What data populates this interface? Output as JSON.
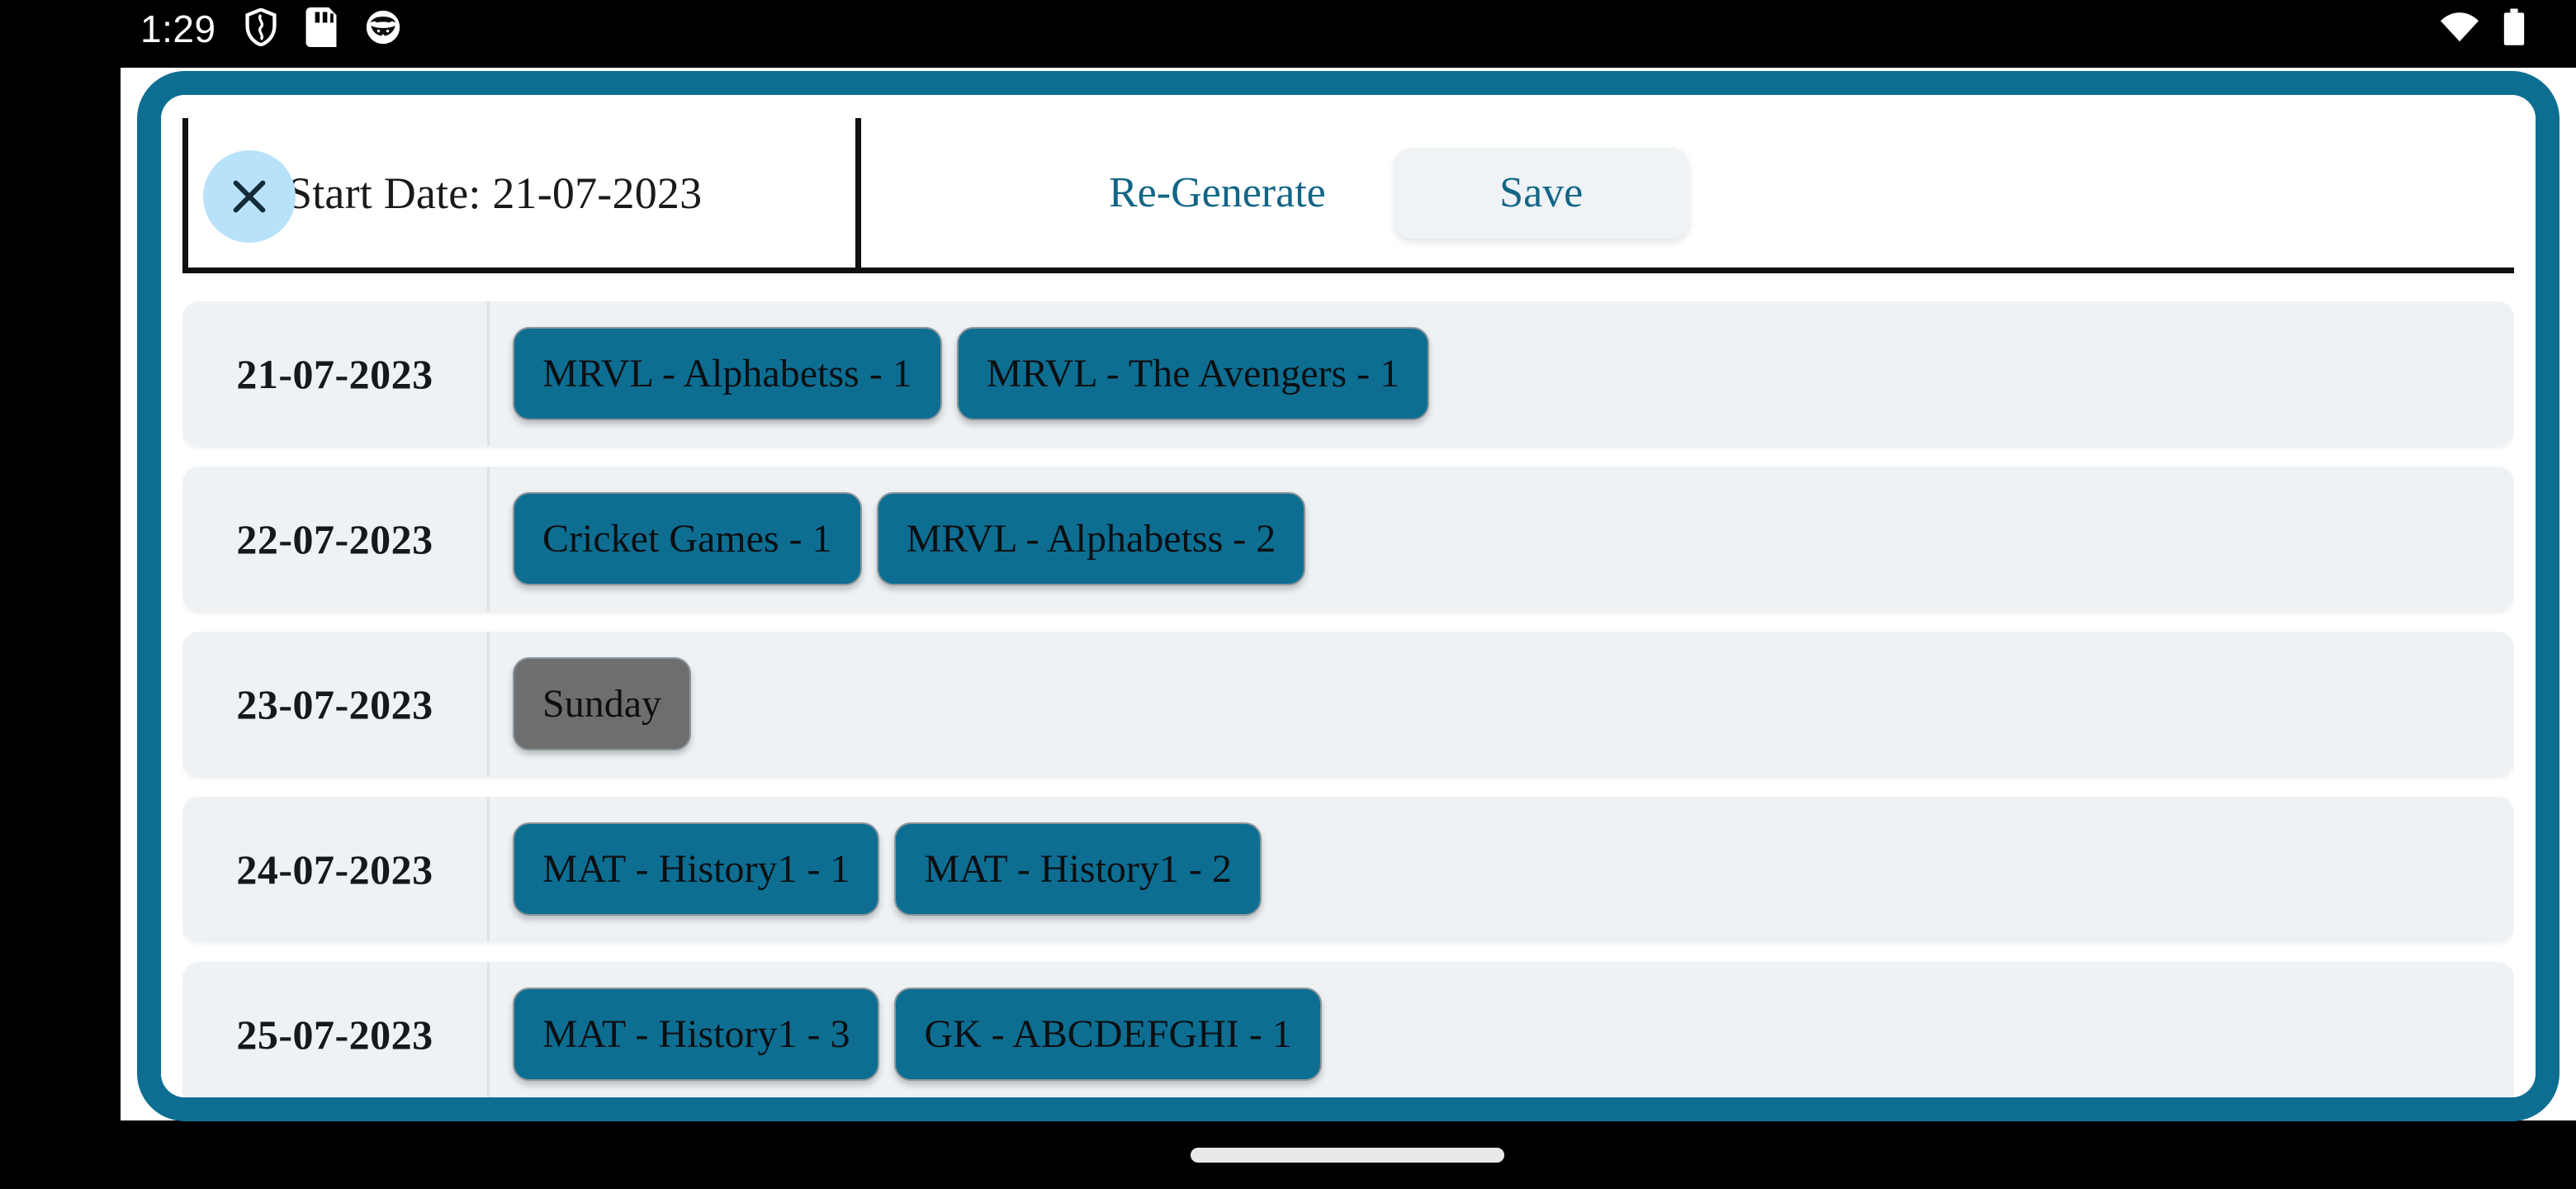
{
  "status_bar": {
    "clock": "1:29",
    "left_icons": [
      "shield-icon",
      "sim-card-icon",
      "cat-face-icon"
    ],
    "right_icons": [
      "wifi-icon",
      "battery-icon"
    ]
  },
  "header": {
    "title": "Start Date: 21-07-2023",
    "close_label": "close-icon",
    "regenerate_label": "Re-Generate",
    "save_label": "Save"
  },
  "theme": {
    "frame": "#0e6e91",
    "chip": "#0d6e92",
    "chip_holiday": "#6e6e6e",
    "accent_text": "#126585",
    "close_circle": "#b7e2fa",
    "row_bg": "#eef2f5",
    "save_bg": "#eff3f6"
  },
  "schedule": {
    "rows": [
      {
        "date": "21-07-2023",
        "chips": [
          {
            "label": "MRVL - Alphabetss - 1",
            "type": "session"
          },
          {
            "label": "MRVL - The Avengers - 1",
            "type": "session"
          }
        ]
      },
      {
        "date": "22-07-2023",
        "chips": [
          {
            "label": "Cricket Games - 1",
            "type": "session"
          },
          {
            "label": "MRVL - Alphabetss - 2",
            "type": "session"
          }
        ]
      },
      {
        "date": "23-07-2023",
        "chips": [
          {
            "label": "Sunday",
            "type": "holiday"
          }
        ]
      },
      {
        "date": "24-07-2023",
        "chips": [
          {
            "label": "MAT - History1 - 1",
            "type": "session"
          },
          {
            "label": "MAT - History1 - 2",
            "type": "session"
          }
        ]
      },
      {
        "date": "25-07-2023",
        "chips": [
          {
            "label": "MAT - History1 - 3",
            "type": "session"
          },
          {
            "label": "GK - ABCDEFGHI - 1",
            "type": "session"
          }
        ]
      }
    ]
  }
}
